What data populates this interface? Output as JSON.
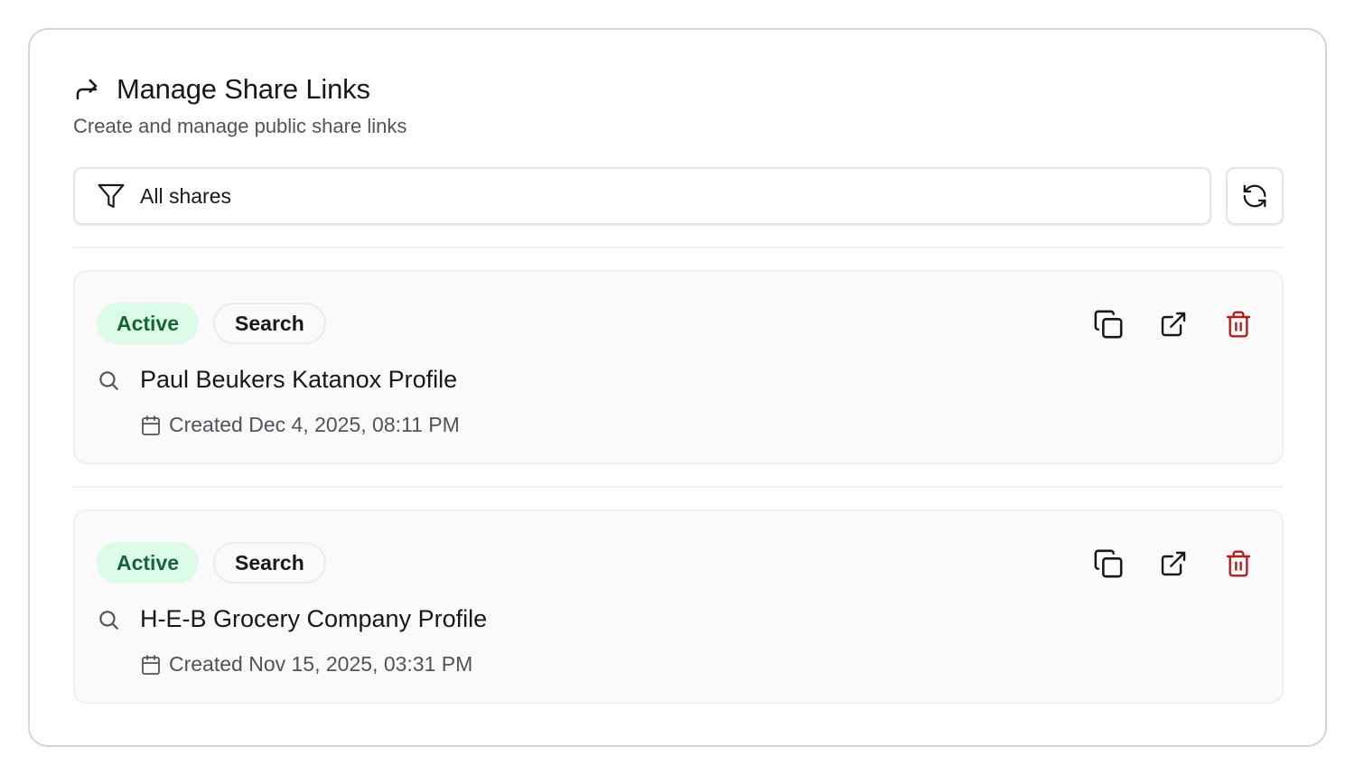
{
  "header": {
    "title": "Manage Share Links",
    "subtitle": "Create and manage public share links"
  },
  "filter": {
    "selected": "All shares"
  },
  "shares": [
    {
      "status": "Active",
      "type": "Search",
      "title": "Paul Beukers Katanox Profile",
      "created": "Created Dec 4, 2025, 08:11 PM"
    },
    {
      "status": "Active",
      "type": "Search",
      "title": "H-E-B Grocery Company Profile",
      "created": "Created Nov 15, 2025, 03:31 PM"
    }
  ],
  "colors": {
    "active_bg": "#dcfce7",
    "active_text": "#166534",
    "delete": "#b91c1c",
    "border": "#d4d4d8"
  },
  "icons": [
    "share-forward-icon",
    "filter-icon",
    "refresh-icon",
    "search-icon",
    "calendar-icon",
    "copy-icon",
    "external-link-icon",
    "trash-icon"
  ]
}
